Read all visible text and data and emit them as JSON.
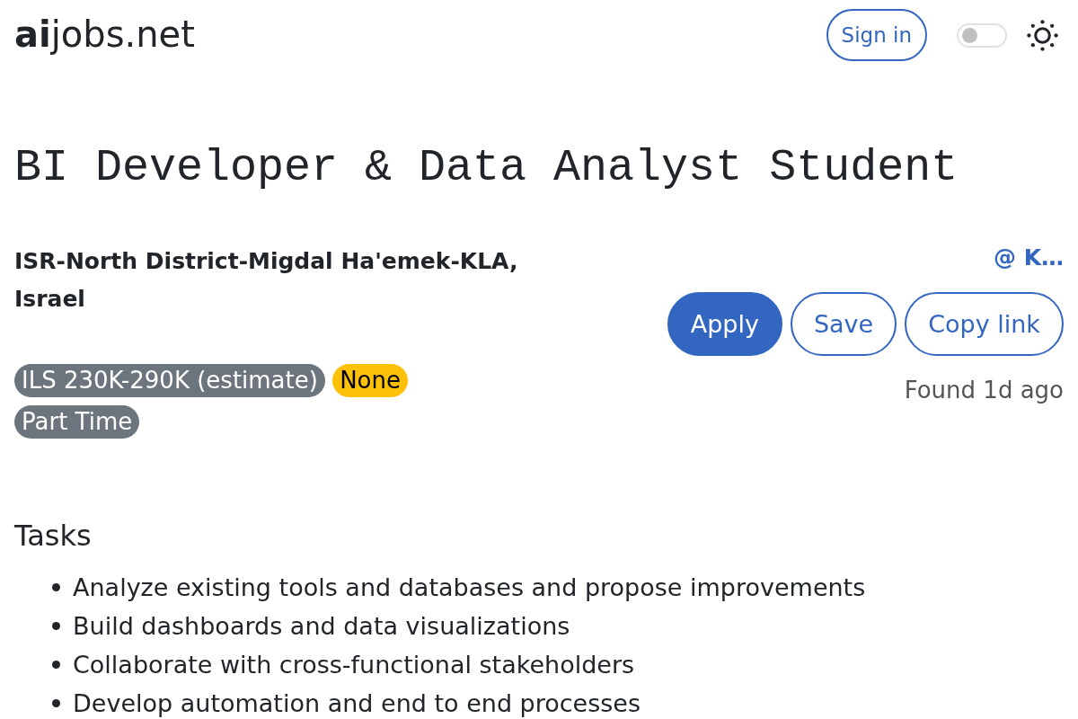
{
  "header": {
    "logo": "**ai**jobs.net",
    "sign_in": "Sign in",
    "theme_toggle": {
      "on": false
    }
  },
  "job": {
    "title": "BI Developer & Data Analyst Student",
    "location": "ISR-North District-Migdal Ha'emek-KLA, Israel",
    "company": "@ K…",
    "actions": [
      {
        "label": "Apply",
        "kind": "primary"
      },
      {
        "label": "Save",
        "kind": "outline"
      },
      {
        "label": "Copy link",
        "kind": "outline"
      }
    ],
    "tags": [
      {
        "label": "ILS 230K-290K (estimate)",
        "color": "#6c757d"
      },
      {
        "label": "None",
        "color": "#ffc107"
      },
      {
        "label": "Part Time",
        "color": "#6c757d"
      }
    ],
    "found": "Found 1d ago"
  },
  "tasks": {
    "heading": "Tasks",
    "items": [
      "Analyze existing tools and databases and propose improvements",
      "Build dashboards and data visualizations",
      "Collaborate with cross-functional stakeholders",
      "Develop automation and end to end processes"
    ]
  }
}
